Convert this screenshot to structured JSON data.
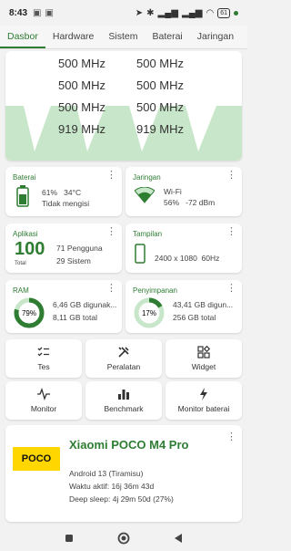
{
  "status": {
    "time": "8:43",
    "battery": "61"
  },
  "tabs": [
    "Dasbor",
    "Hardware",
    "Sistem",
    "Baterai",
    "Jaringan",
    "A"
  ],
  "cpu": {
    "freqs": [
      "500 MHz",
      "500 MHz",
      "500 MHz",
      "500 MHz",
      "500 MHz",
      "500 MHz",
      "919 MHz",
      "919 MHz"
    ]
  },
  "battery": {
    "title": "Baterai",
    "percent": "61%",
    "temp": "34°C",
    "status": "Tidak mengisi",
    "level": 0.61
  },
  "network": {
    "title": "Jaringan",
    "type": "Wi-Fi",
    "signal": "56%",
    "dbm": "-72 dBm"
  },
  "apps": {
    "title": "Aplikasi",
    "total": "100",
    "total_label": "Total",
    "user": "71 Pengguna",
    "system": "29 Sistem"
  },
  "display": {
    "title": "Tampilan",
    "resolution": "2400 x 1080",
    "refresh": "60Hz"
  },
  "ram": {
    "title": "RAM",
    "percent": "79%",
    "used": "6,46 GB digunak...",
    "total": "8,11 GB total",
    "fraction": 0.79
  },
  "storage": {
    "title": "Penyimpanan",
    "percent": "17%",
    "used": "43,41 GB digun...",
    "total": "256 GB total",
    "fraction": 0.17
  },
  "tools": [
    {
      "label": "Tes",
      "icon": "checklist-icon"
    },
    {
      "label": "Peralatan",
      "icon": "tools-icon"
    },
    {
      "label": "Widget",
      "icon": "widget-icon"
    },
    {
      "label": "Monitor",
      "icon": "pulse-icon"
    },
    {
      "label": "Benchmark",
      "icon": "bar-chart-icon"
    },
    {
      "label": "Monitor baterai",
      "icon": "lightning-icon"
    }
  ],
  "device": {
    "logo": "POCO",
    "name": "Xiaomi POCO M4 Pro",
    "android": "Android 13 (Tiramisu)",
    "uptime": "Waktu aktif: 16j 36m 43d",
    "deep_sleep": "Deep sleep: 4j 29m 50d (27%)"
  },
  "colors": {
    "accent": "#2e7d32",
    "light_green": "#c8e6c9",
    "poco_yellow": "#ffd600"
  }
}
